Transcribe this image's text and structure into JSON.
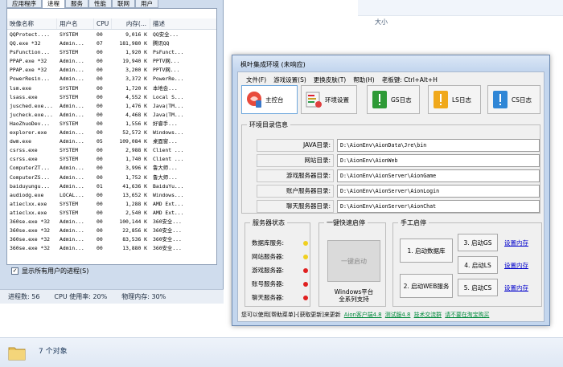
{
  "explorer": {
    "size_header": "大小",
    "status_count": "7 个对象"
  },
  "taskmgr": {
    "tabs": [
      "应用程序",
      "进程",
      "服务",
      "性能",
      "联网",
      "用户"
    ],
    "columns": [
      "映像名称",
      "用户名",
      "CPU",
      "内存(...",
      "描述"
    ],
    "rows": [
      [
        "QQProtect....",
        "SYSTEM",
        "00",
        "9,016 K",
        "QQ安全..."
      ],
      [
        "QQ.exe *32",
        "Admin...",
        "07",
        "181,980 K",
        "腾讯QQ"
      ],
      [
        "PsFunction...",
        "SYSTEM",
        "00",
        "1,920 K",
        "PsFunct..."
      ],
      [
        "PPAP.exe *32",
        "Admin...",
        "00",
        "19,940 K",
        "PPTV网..."
      ],
      [
        "PPAP.exe *32",
        "Admin...",
        "00",
        "3,200 K",
        "PPTV网..."
      ],
      [
        "PowerResin...",
        "Admin...",
        "00",
        "3,372 K",
        "PowerRe..."
      ],
      [
        "lsm.exe",
        "SYSTEM",
        "00",
        "1,720 K",
        "本地会..."
      ],
      [
        "lsass.exe",
        "SYSTEM",
        "00",
        "4,552 K",
        "Local S..."
      ],
      [
        "jusched.exe...",
        "Admin...",
        "00",
        "1,476 K",
        "Java(TM..."
      ],
      [
        "jucheck.exe...",
        "Admin...",
        "00",
        "4,468 K",
        "Java(TM..."
      ],
      [
        "HaoZhuoDev...",
        "SYSTEM",
        "00",
        "1,556 K",
        "好睿手..."
      ],
      [
        "explorer.exe",
        "Admin...",
        "00",
        "52,572 K",
        "Windows..."
      ],
      [
        "dwm.exe",
        "Admin...",
        "05",
        "109,084 K",
        "桌面窗..."
      ],
      [
        "csrss.exe",
        "SYSTEM",
        "00",
        "2,988 K",
        "Client ..."
      ],
      [
        "csrss.exe",
        "SYSTEM",
        "00",
        "1,740 K",
        "Client ..."
      ],
      [
        "ComputerZT...",
        "Admin...",
        "00",
        "3,996 K",
        "鲁大师..."
      ],
      [
        "ComputerZS...",
        "Admin...",
        "00",
        "1,752 K",
        "鲁大师..."
      ],
      [
        "baiduyungu...",
        "Admin...",
        "01",
        "41,636 K",
        "BaiduYu..."
      ],
      [
        "audiodg.exe",
        "LOCAL...",
        "00",
        "13,652 K",
        "Windows..."
      ],
      [
        "atieclxx.exe",
        "SYSTEM",
        "00",
        "1,288 K",
        "AMD Ext..."
      ],
      [
        "atieclxx.exe",
        "SYSTEM",
        "00",
        "2,540 K",
        "AMD Ext..."
      ],
      [
        "360se.exe *32",
        "Admin...",
        "00",
        "100,144 K",
        "360安全..."
      ],
      [
        "360se.exe *32",
        "Admin...",
        "00",
        "22,856 K",
        "360安全..."
      ],
      [
        "360se.exe *32",
        "Admin...",
        "00",
        "83,536 K",
        "360安全..."
      ],
      [
        "360se.exe *32",
        "Admin...",
        "00",
        "13,880 K",
        "360安全..."
      ]
    ],
    "show_all": "显示所有用户的进程(S)",
    "status": {
      "processes": "进程数: 56",
      "cpu": "CPU 使用率: 20%",
      "memory": "物理内存: 30%"
    }
  },
  "aion": {
    "title": "枫叶集成环境 (未响应)",
    "menu": [
      "文件(F)",
      "游戏设置(S)",
      "更换皮肤(T)",
      "帮助(H)",
      "老板键: Ctrl+Alt+H"
    ],
    "toolbar": {
      "console": "主控台",
      "env": "环境设置",
      "gs_log": "GS日志",
      "ls_log": "LS日志",
      "cs_log": "CS日志"
    },
    "env_legend": "环境目录信息",
    "env_rows": [
      {
        "label": "JAVA目录:",
        "value": "D:\\AionEnv\\AionData\\Jre\\bin"
      },
      {
        "label": "网站目录:",
        "value": "D:\\AionEnv\\AionWeb"
      },
      {
        "label": "游戏服务器目录:",
        "value": "D:\\AionEnv\\AionServer\\AionGame"
      },
      {
        "label": "账户服务器目录:",
        "value": "D:\\AionEnv\\AionServer\\AionLogin"
      },
      {
        "label": "聊天服务器目录:",
        "value": "D:\\AionEnv\\AionServer\\AionChat"
      }
    ],
    "server_legend": "服务器状态",
    "servers": [
      {
        "label": "数据库服务:",
        "color": "#f0d020"
      },
      {
        "label": "网站服务器:",
        "color": "#f0d020"
      },
      {
        "label": "游戏服务器:",
        "color": "#e02020"
      },
      {
        "label": "账号服务器:",
        "color": "#e02020"
      },
      {
        "label": "聊天服务器:",
        "color": "#e02020"
      }
    ],
    "quick_legend": "一键快速启停",
    "quick_button": "一键启动",
    "quick_note": "Windows平台\n全系列支持",
    "manual_legend": "手工启停",
    "manual": {
      "db": "1. 启动数据库",
      "web": "2. 启动WEB服务",
      "gs": "3. 启动GS",
      "ls": "4. 启动LS",
      "cs": "5. 启动CS",
      "cfg1": "设置内存",
      "cfg2": "设置内存",
      "cfg3": "设置内存"
    },
    "bottom": {
      "text": "您可以使用[帮助菜单]-[获取更新]来更新",
      "links": [
        "Aion客户端4.8",
        "测试服4.8",
        "技术交流群",
        "请不要在淘宝购买"
      ]
    }
  }
}
